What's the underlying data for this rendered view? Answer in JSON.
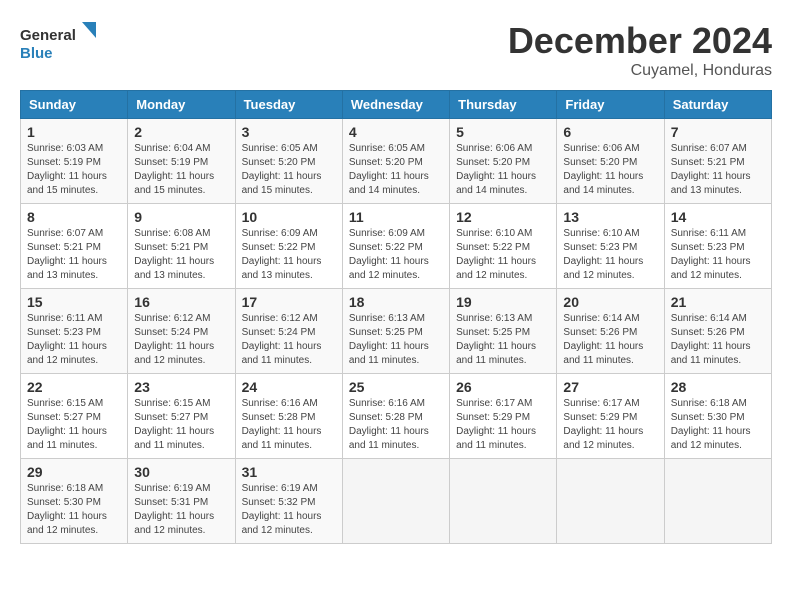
{
  "header": {
    "logo_general": "General",
    "logo_blue": "Blue",
    "month_title": "December 2024",
    "location": "Cuyamel, Honduras"
  },
  "calendar": {
    "days_of_week": [
      "Sunday",
      "Monday",
      "Tuesday",
      "Wednesday",
      "Thursday",
      "Friday",
      "Saturday"
    ],
    "weeks": [
      [
        {
          "day": null,
          "info": null
        },
        {
          "day": null,
          "info": null
        },
        {
          "day": null,
          "info": null
        },
        {
          "day": null,
          "info": null
        },
        {
          "day": null,
          "info": null
        },
        {
          "day": null,
          "info": null
        },
        {
          "day": null,
          "info": null
        }
      ],
      [
        {
          "day": "1",
          "info": "Sunrise: 6:03 AM\nSunset: 5:19 PM\nDaylight: 11 hours\nand 15 minutes."
        },
        {
          "day": "2",
          "info": "Sunrise: 6:04 AM\nSunset: 5:19 PM\nDaylight: 11 hours\nand 15 minutes."
        },
        {
          "day": "3",
          "info": "Sunrise: 6:05 AM\nSunset: 5:20 PM\nDaylight: 11 hours\nand 15 minutes."
        },
        {
          "day": "4",
          "info": "Sunrise: 6:05 AM\nSunset: 5:20 PM\nDaylight: 11 hours\nand 14 minutes."
        },
        {
          "day": "5",
          "info": "Sunrise: 6:06 AM\nSunset: 5:20 PM\nDaylight: 11 hours\nand 14 minutes."
        },
        {
          "day": "6",
          "info": "Sunrise: 6:06 AM\nSunset: 5:20 PM\nDaylight: 11 hours\nand 14 minutes."
        },
        {
          "day": "7",
          "info": "Sunrise: 6:07 AM\nSunset: 5:21 PM\nDaylight: 11 hours\nand 13 minutes."
        }
      ],
      [
        {
          "day": "8",
          "info": "Sunrise: 6:07 AM\nSunset: 5:21 PM\nDaylight: 11 hours\nand 13 minutes."
        },
        {
          "day": "9",
          "info": "Sunrise: 6:08 AM\nSunset: 5:21 PM\nDaylight: 11 hours\nand 13 minutes."
        },
        {
          "day": "10",
          "info": "Sunrise: 6:09 AM\nSunset: 5:22 PM\nDaylight: 11 hours\nand 13 minutes."
        },
        {
          "day": "11",
          "info": "Sunrise: 6:09 AM\nSunset: 5:22 PM\nDaylight: 11 hours\nand 12 minutes."
        },
        {
          "day": "12",
          "info": "Sunrise: 6:10 AM\nSunset: 5:22 PM\nDaylight: 11 hours\nand 12 minutes."
        },
        {
          "day": "13",
          "info": "Sunrise: 6:10 AM\nSunset: 5:23 PM\nDaylight: 11 hours\nand 12 minutes."
        },
        {
          "day": "14",
          "info": "Sunrise: 6:11 AM\nSunset: 5:23 PM\nDaylight: 11 hours\nand 12 minutes."
        }
      ],
      [
        {
          "day": "15",
          "info": "Sunrise: 6:11 AM\nSunset: 5:23 PM\nDaylight: 11 hours\nand 12 minutes."
        },
        {
          "day": "16",
          "info": "Sunrise: 6:12 AM\nSunset: 5:24 PM\nDaylight: 11 hours\nand 12 minutes."
        },
        {
          "day": "17",
          "info": "Sunrise: 6:12 AM\nSunset: 5:24 PM\nDaylight: 11 hours\nand 11 minutes."
        },
        {
          "day": "18",
          "info": "Sunrise: 6:13 AM\nSunset: 5:25 PM\nDaylight: 11 hours\nand 11 minutes."
        },
        {
          "day": "19",
          "info": "Sunrise: 6:13 AM\nSunset: 5:25 PM\nDaylight: 11 hours\nand 11 minutes."
        },
        {
          "day": "20",
          "info": "Sunrise: 6:14 AM\nSunset: 5:26 PM\nDaylight: 11 hours\nand 11 minutes."
        },
        {
          "day": "21",
          "info": "Sunrise: 6:14 AM\nSunset: 5:26 PM\nDaylight: 11 hours\nand 11 minutes."
        }
      ],
      [
        {
          "day": "22",
          "info": "Sunrise: 6:15 AM\nSunset: 5:27 PM\nDaylight: 11 hours\nand 11 minutes."
        },
        {
          "day": "23",
          "info": "Sunrise: 6:15 AM\nSunset: 5:27 PM\nDaylight: 11 hours\nand 11 minutes."
        },
        {
          "day": "24",
          "info": "Sunrise: 6:16 AM\nSunset: 5:28 PM\nDaylight: 11 hours\nand 11 minutes."
        },
        {
          "day": "25",
          "info": "Sunrise: 6:16 AM\nSunset: 5:28 PM\nDaylight: 11 hours\nand 11 minutes."
        },
        {
          "day": "26",
          "info": "Sunrise: 6:17 AM\nSunset: 5:29 PM\nDaylight: 11 hours\nand 11 minutes."
        },
        {
          "day": "27",
          "info": "Sunrise: 6:17 AM\nSunset: 5:29 PM\nDaylight: 11 hours\nand 12 minutes."
        },
        {
          "day": "28",
          "info": "Sunrise: 6:18 AM\nSunset: 5:30 PM\nDaylight: 11 hours\nand 12 minutes."
        }
      ],
      [
        {
          "day": "29",
          "info": "Sunrise: 6:18 AM\nSunset: 5:30 PM\nDaylight: 11 hours\nand 12 minutes."
        },
        {
          "day": "30",
          "info": "Sunrise: 6:19 AM\nSunset: 5:31 PM\nDaylight: 11 hours\nand 12 minutes."
        },
        {
          "day": "31",
          "info": "Sunrise: 6:19 AM\nSunset: 5:32 PM\nDaylight: 11 hours\nand 12 minutes."
        },
        {
          "day": null,
          "info": null
        },
        {
          "day": null,
          "info": null
        },
        {
          "day": null,
          "info": null
        },
        {
          "day": null,
          "info": null
        }
      ]
    ]
  }
}
